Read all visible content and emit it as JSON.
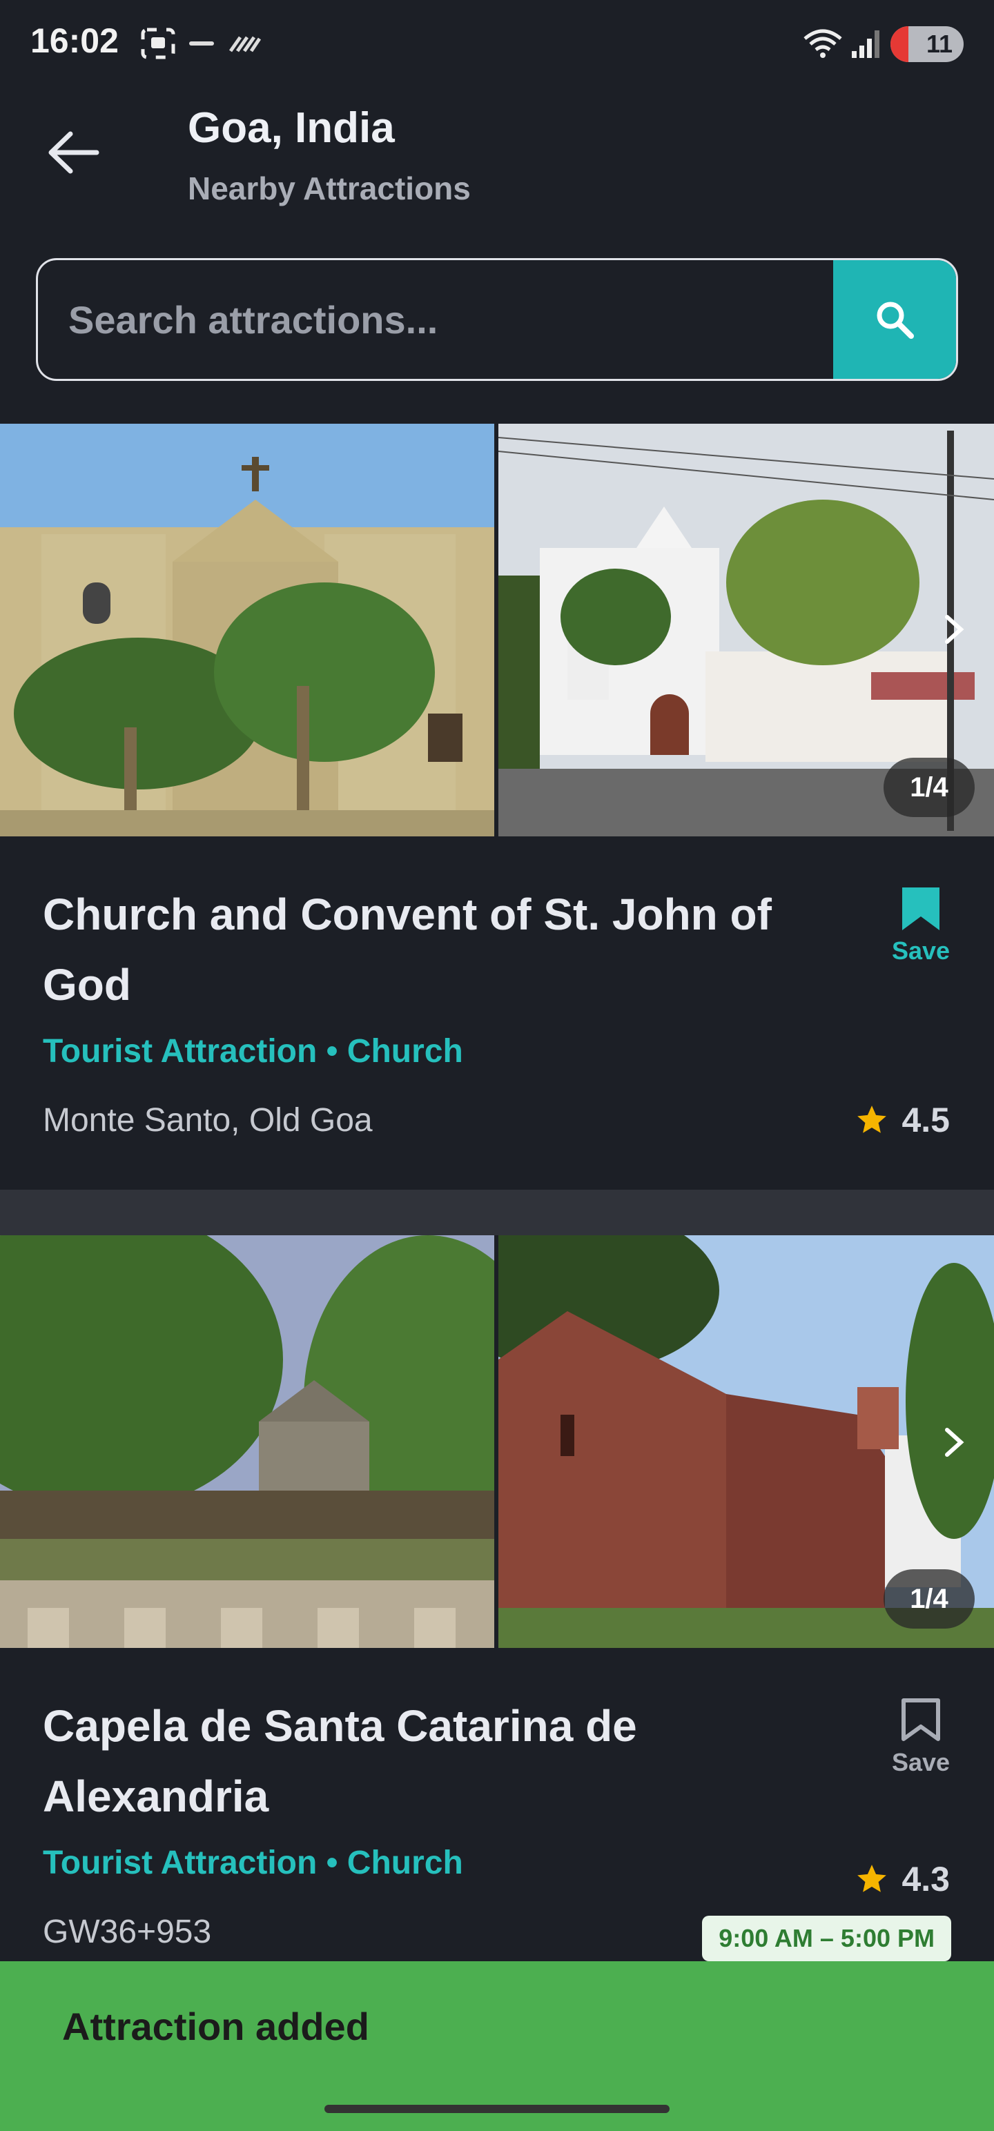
{
  "status_bar": {
    "time": "16:02",
    "battery": "11",
    "icons": [
      "screenshot-icon",
      "rapido-icon",
      "stripes-icon",
      "wifi-icon",
      "signal-icon",
      "battery-icon"
    ]
  },
  "header": {
    "title": "Goa, India",
    "subtitle": "Nearby Attractions"
  },
  "search": {
    "placeholder": "Search attractions..."
  },
  "attractions": [
    {
      "name": "Church and Convent of St. John of God",
      "category": "Tourist Attraction • Church",
      "address": "Monte Santo, Old Goa",
      "rating": "4.5",
      "save_label": "Save",
      "saved": true,
      "photo_counter": "1/4"
    },
    {
      "name": "Capela de Santa Catarina de Alexandria",
      "category": "Tourist Attraction • Church",
      "address": "GW36+953",
      "rating": "4.3",
      "save_label": "Save",
      "saved": false,
      "photo_counter": "1/4",
      "hours": "9:00 AM – 5:00 PM"
    }
  ],
  "snackbar": {
    "message": "Attraction added"
  },
  "colors": {
    "background": "#1c1f26",
    "accent": "#1fb5b4",
    "snackbar": "#4caf50",
    "star": "#f5b400"
  }
}
